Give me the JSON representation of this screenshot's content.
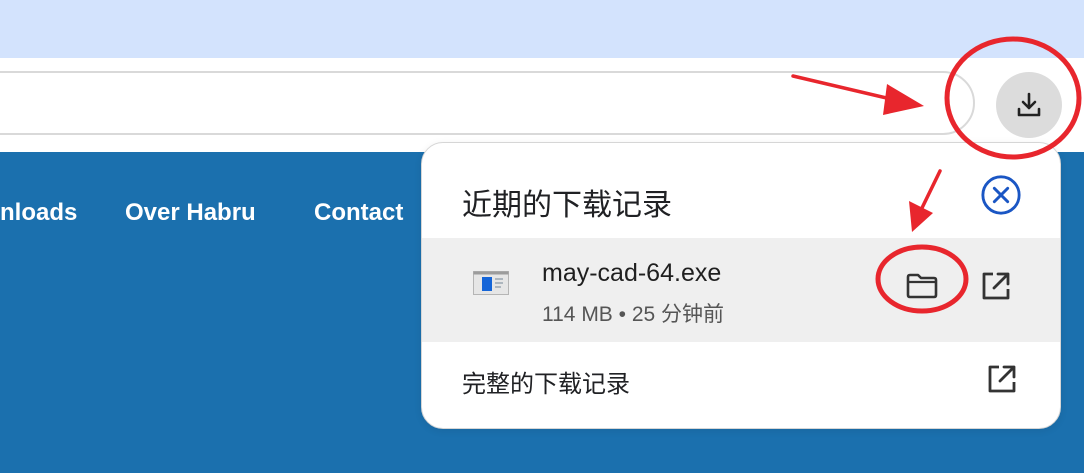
{
  "browser": {
    "download_button_icon": "download-icon"
  },
  "site": {
    "nav": [
      {
        "label": "nloads"
      },
      {
        "label": "Over Habru"
      },
      {
        "label": "Contact"
      }
    ]
  },
  "download_panel": {
    "title": "近期的下载记录",
    "close_icon": "close-circle-icon",
    "items": [
      {
        "file_name": "may-cad-64.exe",
        "meta": "114 MB • 25 分钟前",
        "file_icon": "exe-file-icon",
        "folder_icon": "folder-icon",
        "open_icon": "open-external-icon"
      }
    ],
    "full_history_label": "完整的下载记录",
    "full_history_icon": "open-external-icon"
  },
  "annotations": {
    "color": "#e8262d"
  },
  "colors": {
    "tabstrip": "#d3e3fd",
    "site_background": "#1b70ae",
    "accent_blue": "#1a56c4"
  }
}
